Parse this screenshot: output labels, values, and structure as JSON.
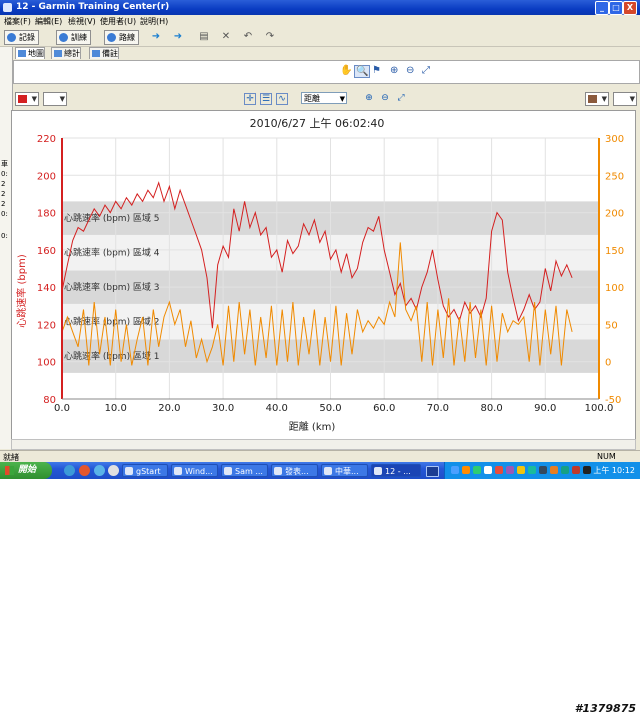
{
  "window": {
    "title": "12 - Garmin Training Center(r)",
    "buttons": [
      "_",
      "□",
      "X"
    ]
  },
  "menu": [
    "檔案(F)",
    "編輯(E)",
    "檢視(V)",
    "使用者(U)",
    "說明(H)"
  ],
  "toolbar": {
    "buttons": [
      "記錄",
      "訓練",
      "路線"
    ]
  },
  "tabs": [
    "地圖",
    "總計",
    "備註"
  ],
  "left_strip": [
    "車",
    "0:",
    "2",
    "2",
    "2",
    "0:",
    "0:"
  ],
  "chart_toolbar": {
    "x_axis_select": "距離"
  },
  "status": {
    "left": "就緒",
    "right": "NUM"
  },
  "taskbar": {
    "start": "開始",
    "tasks": [
      "gStart",
      "Wind...",
      "Sam ...",
      "發表...",
      "中華...",
      "12 - ..."
    ],
    "clock": "上午 10:12"
  },
  "watermark": "#1379875",
  "colors": {
    "hr": "#d42020",
    "secondary": "#f08a00",
    "zone_band": "#d8d8d8"
  },
  "chart_data": {
    "type": "line",
    "title": "2010/6/27 上午 06:02:40",
    "xlabel": "距離 (km)",
    "ylabel": "心跳速率 (bpm)",
    "xlim": [
      0,
      100
    ],
    "ylim": [
      80,
      220
    ],
    "y2lim": [
      -50,
      300
    ],
    "x_ticks": [
      "0.0",
      "10.0",
      "20.0",
      "30.0",
      "40.0",
      "50.0",
      "60.0",
      "70.0",
      "80.0",
      "90.0",
      "100.0"
    ],
    "y_ticks": [
      "80",
      "100",
      "120",
      "140",
      "160",
      "180",
      "200",
      "220"
    ],
    "y2_ticks": [
      "-50",
      "0",
      "50",
      "100",
      "150",
      "200",
      "250",
      "300"
    ],
    "grid": true,
    "zones": [
      {
        "label": "心跳速率 (bpm) 區域 1",
        "low": 94,
        "high": 112
      },
      {
        "label": "心跳速率 (bpm) 區域 2",
        "low": 112,
        "high": 131
      },
      {
        "label": "心跳速率 (bpm) 區域 3",
        "low": 131,
        "high": 149
      },
      {
        "label": "心跳速率 (bpm) 區域 4",
        "low": 149,
        "high": 168
      },
      {
        "label": "心跳速率 (bpm) 區域 5",
        "low": 168,
        "high": 186
      }
    ],
    "series": [
      {
        "color": "#d42020",
        "axis": "left",
        "points": [
          [
            0,
            138
          ],
          [
            1,
            152
          ],
          [
            2,
            165
          ],
          [
            3,
            172
          ],
          [
            4,
            170
          ],
          [
            5,
            176
          ],
          [
            6,
            182
          ],
          [
            7,
            178
          ],
          [
            8,
            184
          ],
          [
            9,
            180
          ],
          [
            10,
            186
          ],
          [
            11,
            182
          ],
          [
            12,
            188
          ],
          [
            13,
            184
          ],
          [
            14,
            190
          ],
          [
            15,
            186
          ],
          [
            16,
            192
          ],
          [
            17,
            188
          ],
          [
            18,
            196
          ],
          [
            19,
            186
          ],
          [
            20,
            194
          ],
          [
            21,
            182
          ],
          [
            22,
            192
          ],
          [
            23,
            184
          ],
          [
            24,
            176
          ],
          [
            25,
            168
          ],
          [
            26,
            160
          ],
          [
            27,
            145
          ],
          [
            28,
            118
          ],
          [
            29,
            152
          ],
          [
            30,
            162
          ],
          [
            31,
            156
          ],
          [
            32,
            182
          ],
          [
            33,
            170
          ],
          [
            34,
            186
          ],
          [
            35,
            172
          ],
          [
            36,
            180
          ],
          [
            37,
            168
          ],
          [
            38,
            172
          ],
          [
            39,
            156
          ],
          [
            40,
            160
          ],
          [
            41,
            148
          ],
          [
            42,
            165
          ],
          [
            43,
            158
          ],
          [
            44,
            162
          ],
          [
            45,
            174
          ],
          [
            46,
            168
          ],
          [
            47,
            176
          ],
          [
            48,
            164
          ],
          [
            49,
            170
          ],
          [
            50,
            155
          ],
          [
            51,
            160
          ],
          [
            52,
            148
          ],
          [
            53,
            158
          ],
          [
            54,
            145
          ],
          [
            55,
            150
          ],
          [
            56,
            164
          ],
          [
            57,
            172
          ],
          [
            58,
            170
          ],
          [
            59,
            178
          ],
          [
            60,
            160
          ],
          [
            61,
            148
          ],
          [
            62,
            136
          ],
          [
            63,
            142
          ],
          [
            64,
            130
          ],
          [
            65,
            134
          ],
          [
            66,
            128
          ],
          [
            67,
            140
          ],
          [
            68,
            148
          ],
          [
            69,
            160
          ],
          [
            70,
            144
          ],
          [
            71,
            130
          ],
          [
            72,
            124
          ],
          [
            73,
            128
          ],
          [
            74,
            122
          ],
          [
            75,
            132
          ],
          [
            76,
            126
          ],
          [
            77,
            130
          ],
          [
            78,
            124
          ],
          [
            79,
            134
          ],
          [
            80,
            170
          ],
          [
            81,
            180
          ],
          [
            82,
            176
          ],
          [
            83,
            148
          ],
          [
            84,
            134
          ],
          [
            85,
            122
          ],
          [
            86,
            128
          ],
          [
            87,
            136
          ],
          [
            88,
            128
          ],
          [
            89,
            132
          ],
          [
            90,
            150
          ],
          [
            91,
            138
          ],
          [
            92,
            154
          ],
          [
            93,
            146
          ],
          [
            94,
            152
          ],
          [
            95,
            145
          ]
        ]
      },
      {
        "color": "#f08a00",
        "axis": "right",
        "points": [
          [
            0,
            40
          ],
          [
            1,
            60
          ],
          [
            2,
            40
          ],
          [
            3,
            20
          ],
          [
            4,
            70
          ],
          [
            5,
            -5
          ],
          [
            6,
            80
          ],
          [
            7,
            10
          ],
          [
            8,
            60
          ],
          [
            9,
            -5
          ],
          [
            10,
            70
          ],
          [
            11,
            0
          ],
          [
            12,
            50
          ],
          [
            13,
            -5
          ],
          [
            14,
            30
          ],
          [
            15,
            60
          ],
          [
            16,
            -5
          ],
          [
            17,
            70
          ],
          [
            18,
            20
          ],
          [
            19,
            60
          ],
          [
            20,
            80
          ],
          [
            21,
            50
          ],
          [
            22,
            70
          ],
          [
            23,
            20
          ],
          [
            24,
            55
          ],
          [
            25,
            5
          ],
          [
            26,
            30
          ],
          [
            27,
            0
          ],
          [
            28,
            20
          ],
          [
            29,
            50
          ],
          [
            30,
            -5
          ],
          [
            31,
            75
          ],
          [
            32,
            0
          ],
          [
            33,
            80
          ],
          [
            34,
            10
          ],
          [
            35,
            70
          ],
          [
            36,
            -5
          ],
          [
            37,
            60
          ],
          [
            38,
            5
          ],
          [
            39,
            75
          ],
          [
            40,
            -5
          ],
          [
            41,
            70
          ],
          [
            42,
            0
          ],
          [
            43,
            80
          ],
          [
            44,
            -5
          ],
          [
            45,
            60
          ],
          [
            46,
            10
          ],
          [
            47,
            70
          ],
          [
            48,
            -5
          ],
          [
            49,
            60
          ],
          [
            50,
            0
          ],
          [
            51,
            75
          ],
          [
            52,
            -5
          ],
          [
            53,
            65
          ],
          [
            54,
            10
          ],
          [
            55,
            70
          ],
          [
            56,
            40
          ],
          [
            57,
            55
          ],
          [
            58,
            45
          ],
          [
            59,
            60
          ],
          [
            60,
            50
          ],
          [
            61,
            80
          ],
          [
            62,
            60
          ],
          [
            63,
            160
          ],
          [
            64,
            70
          ],
          [
            65,
            55
          ],
          [
            66,
            75
          ],
          [
            67,
            0
          ],
          [
            68,
            80
          ],
          [
            69,
            -5
          ],
          [
            70,
            70
          ],
          [
            71,
            5
          ],
          [
            72,
            85
          ],
          [
            73,
            -5
          ],
          [
            74,
            60
          ],
          [
            75,
            0
          ],
          [
            76,
            80
          ],
          [
            77,
            5
          ],
          [
            78,
            70
          ],
          [
            79,
            -5
          ],
          [
            80,
            75
          ],
          [
            81,
            0
          ],
          [
            82,
            65
          ],
          [
            83,
            40
          ],
          [
            84,
            55
          ],
          [
            85,
            50
          ],
          [
            86,
            60
          ],
          [
            87,
            0
          ],
          [
            88,
            80
          ],
          [
            89,
            -5
          ],
          [
            90,
            70
          ],
          [
            91,
            10
          ],
          [
            92,
            75
          ],
          [
            93,
            -5
          ],
          [
            94,
            70
          ],
          [
            95,
            40
          ]
        ]
      }
    ]
  }
}
